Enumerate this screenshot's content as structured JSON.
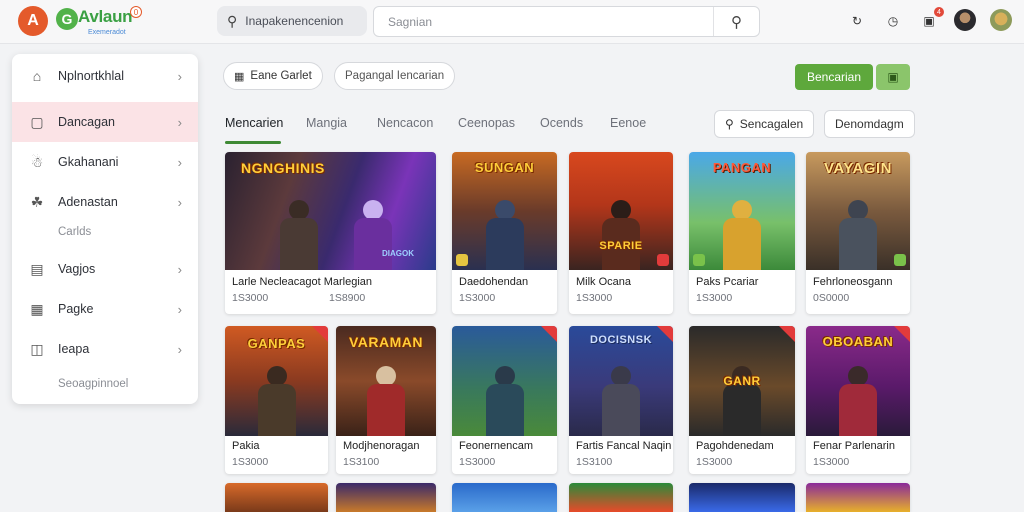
{
  "header": {
    "logo_glyph": "A",
    "brand_glyph": "G",
    "brand_name": "Avlaun",
    "brand_badge": "0",
    "brand_subtitle": "Exemeradot",
    "quick_search_label": "Inapakenencenion",
    "search_placeholder": "Sagnian",
    "search_icon": "magnifier-icon",
    "notification_count": "4"
  },
  "sidebar": {
    "items": [
      {
        "label": "Nplnortkhlal",
        "icon": "home-icon"
      },
      {
        "label": "Dancagan",
        "icon": "tv-icon"
      },
      {
        "label": "Gkahanani",
        "icon": "gamepad-icon"
      },
      {
        "label": "Adenastan",
        "icon": "puzzle-icon"
      },
      {
        "label": "Vagjos",
        "icon": "controller-icon"
      },
      {
        "label": "Pagke",
        "icon": "folder-icon"
      },
      {
        "label": "Ieapa",
        "icon": "box-icon"
      }
    ],
    "sub_cards": "Carlds",
    "sub_footer": "Seoagpinnoel"
  },
  "filters": {
    "pill1": "Eane Garlet",
    "pill2": "Pagangal Iencarian",
    "primary_button": "Bencarian",
    "secondary_icon": "chip-icon"
  },
  "tabs": [
    "Mencarien",
    "Mangia",
    "Nencacon",
    "Ceenopas",
    "Ocends",
    "Eenoe"
  ],
  "actions": {
    "sort_label": "Sencagalen",
    "sort_icon": "pin-icon",
    "menu_label": "Denomdagm"
  },
  "cards": [
    {
      "title": "Larle Necleacagot Marlegian",
      "meta": "1S3000",
      "extra": "1S8900",
      "art": "NGNGHINIS",
      "art_sub": "DIAGOK"
    },
    {
      "title": "Daedohendan",
      "meta": "1S3000",
      "art": "SUNGAN"
    },
    {
      "title": "Milk Ocana",
      "meta": "1S3000",
      "art": "SPARIE"
    },
    {
      "title": "Paks Pcariar",
      "meta": "1S3000",
      "art": "PANGAN"
    },
    {
      "title": "Fehrloneosgann",
      "meta": "0S0000",
      "art": "VAYAGIN"
    },
    {
      "title": "Pakia",
      "meta": "1S3000",
      "art": "GANPAS"
    },
    {
      "title": "Modjhenoragan",
      "meta": "1S3100",
      "art": "VARAMAN"
    },
    {
      "title": "Feonernencam",
      "meta": "1S3000",
      "art": ""
    },
    {
      "title": "Fartis Fancal Naqin",
      "meta": "1S3100",
      "art": "DOCISNSK"
    },
    {
      "title": "Pagohdenedam",
      "meta": "1S3000",
      "art": "GANR"
    },
    {
      "title": "Fenar Parlenarin",
      "meta": "1S3000",
      "art": "OBOABAN"
    }
  ],
  "colors": {
    "accent_green": "#5ea83c",
    "active_row": "#fbe3e6",
    "brand_orange": "#e45a2b"
  }
}
